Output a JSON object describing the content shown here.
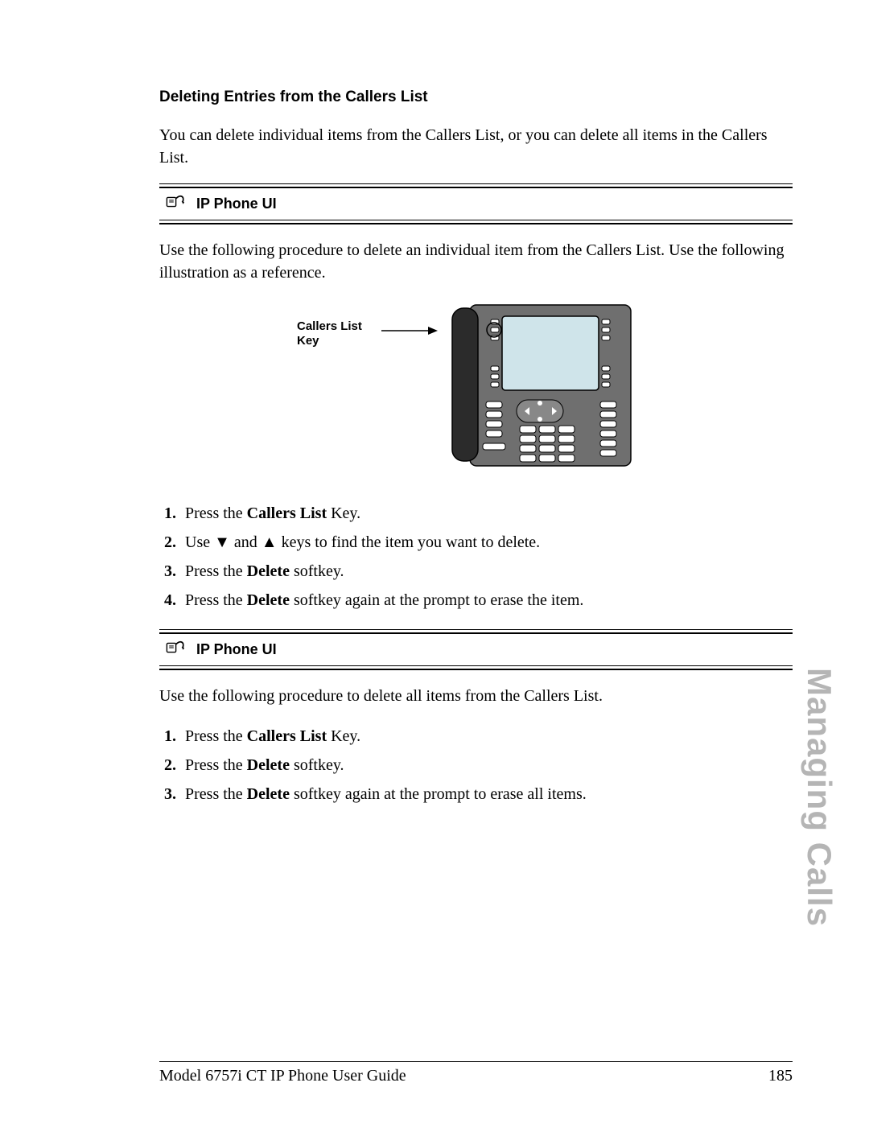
{
  "heading": "Deleting Entries from the Callers List",
  "intro": "You can delete individual items from the Callers List, or you can delete all items in the Callers List.",
  "callout_label": "IP Phone UI",
  "procedure1_intro": "Use the following procedure to delete an individual item from the Callers List. Use the following illustration as a reference.",
  "figure": {
    "label_line1": "Callers List",
    "label_line2": "Key"
  },
  "steps1": {
    "s1_a": "Press the ",
    "s1_b": "Callers List",
    "s1_c": " Key.",
    "s2_a": "Use ",
    "s2_down": "▼",
    "s2_mid": " and ",
    "s2_up": "▲",
    "s2_b": "  keys to find the item you want to delete.",
    "s3_a": "Press the ",
    "s3_b": "Delete",
    "s3_c": " softkey.",
    "s4_a": "Press the ",
    "s4_b": "Delete",
    "s4_c": " softkey again at the prompt to erase the item."
  },
  "procedure2_intro": "Use the following procedure to delete all items from the Callers List.",
  "steps2": {
    "s1_a": "Press the ",
    "s1_b": "Callers List",
    "s1_c": " Key.",
    "s2_a": "Press the ",
    "s2_b": "Delete",
    "s2_c": " softkey.",
    "s3_a": "Press the ",
    "s3_b": "Delete",
    "s3_c": " softkey again at the prompt to erase all items."
  },
  "side_tab": "Managing Calls",
  "footer_left": "Model 6757i CT IP Phone User Guide",
  "footer_right": "185"
}
